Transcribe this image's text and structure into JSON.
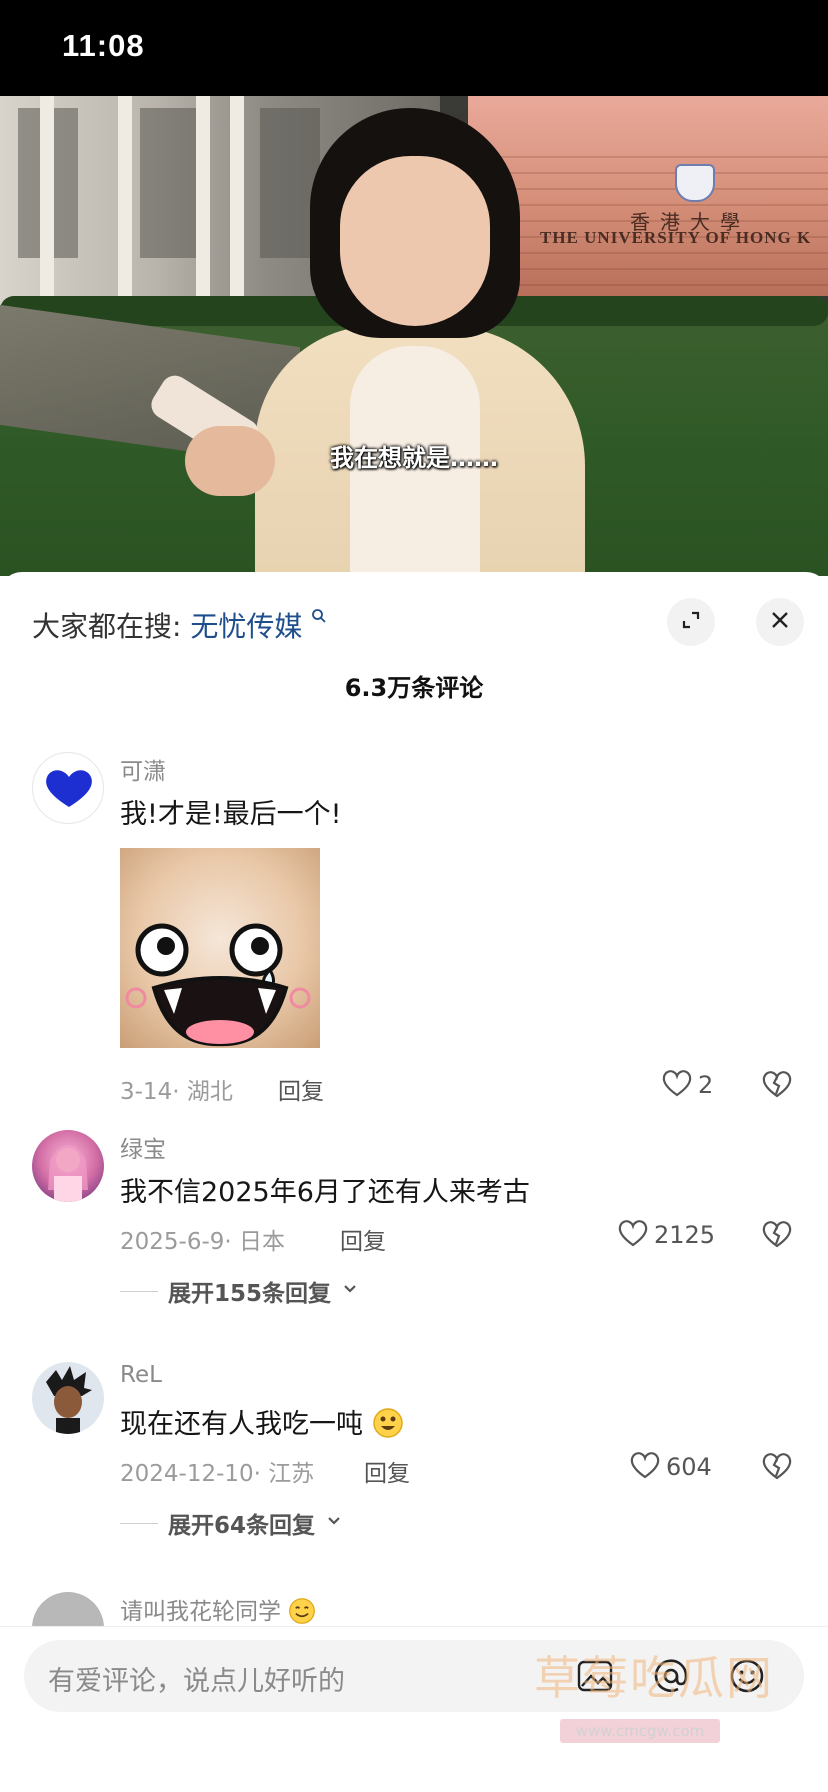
{
  "status_bar": {
    "time": "11:08"
  },
  "video": {
    "sign_cn": "香港大學",
    "sign_en": "THE UNIVERSITY OF HONG K",
    "subtitle": "我在想就是……"
  },
  "sheet": {
    "search_prefix": "大家都在搜:",
    "search_term": "无忧传媒",
    "comment_count": "6.3万条评论"
  },
  "comments": [
    {
      "username": "可潇",
      "text": "我!才是!最后一个!",
      "has_sticker": true,
      "date_location": "3-14· 湖北",
      "reply_label": "回复",
      "likes": "2"
    },
    {
      "username": "绿宝",
      "text": "我不信2025年6月了还有人来考古",
      "date_location": "2025-6-9· 日本",
      "reply_label": "回复",
      "likes": "2125",
      "expand_label": "展开155条回复"
    },
    {
      "username": "ReL",
      "text": "现在还有人我吃一吨",
      "date_location": "2024-12-10· 江苏",
      "reply_label": "回复",
      "likes": "604",
      "expand_label": "展开64条回复"
    },
    {
      "username": "请叫我花轮同学"
    }
  ],
  "input_bar": {
    "placeholder": "有爱评论，说点儿好听的",
    "watermark": "草莓吃瓜网",
    "watermark_url": "www.cmcgw.com"
  },
  "icons": [
    "search-icon",
    "expand-icon",
    "close-icon",
    "heart-icon",
    "broken-heart-icon",
    "chevron-down-icon",
    "emoji-icon",
    "mention-icon"
  ],
  "colors": {
    "accent_link": "#1f4e8c",
    "meta_gray": "#9b9b9b"
  }
}
